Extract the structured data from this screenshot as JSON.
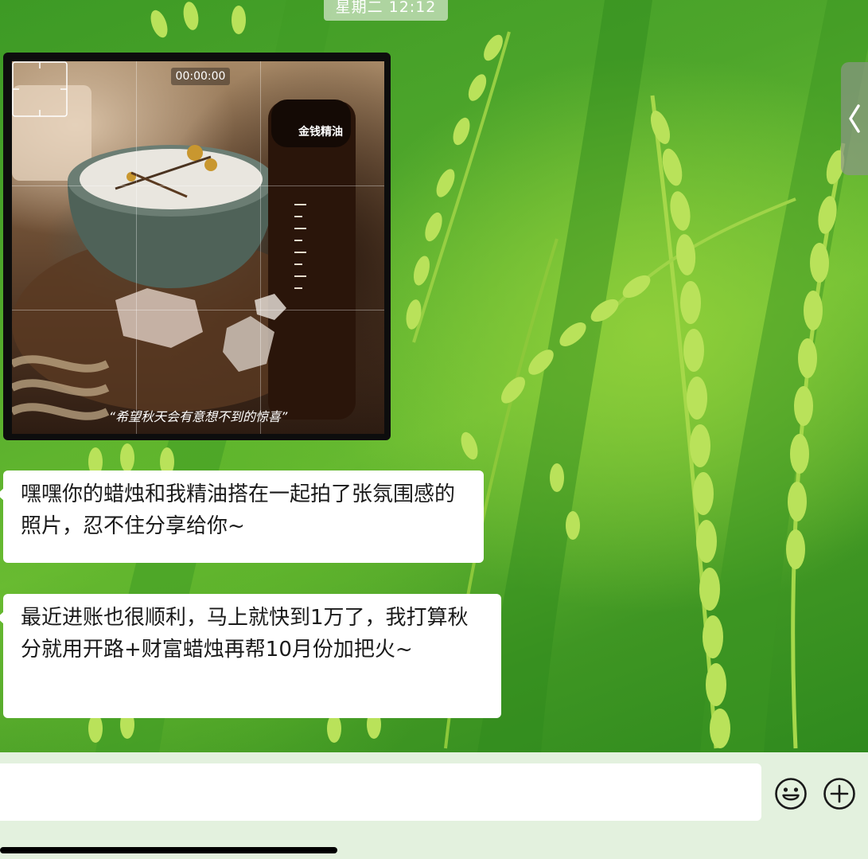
{
  "chat": {
    "timestamp": "星期二 12:12",
    "video_message": {
      "duration": "00:00:00",
      "bottle_label": "金钱精油",
      "caption": "“希望秋天会有意想不到的惊喜”"
    },
    "messages": [
      {
        "text": "嘿嘿你的蜡烛和我精油搭在一起拍了张氛围感的照片，忍不住分享给你~"
      },
      {
        "text": "最近进账也很顺利，马上就快到1万了，我打算秋分就用开路+财富蜡烛再帮10月份加把火~"
      }
    ]
  },
  "side_tab": {
    "icon": "chevron-left-icon"
  },
  "input_bar": {
    "value": "",
    "emoji_icon": "smiley-icon",
    "plus_icon": "plus-circle-icon"
  },
  "colors": {
    "wallpaper_green": "#4ea62b",
    "bubble_bg": "#ffffff",
    "input_bar_bg": "#e3f1de",
    "timestamp_bg": "#d2e6c8"
  }
}
